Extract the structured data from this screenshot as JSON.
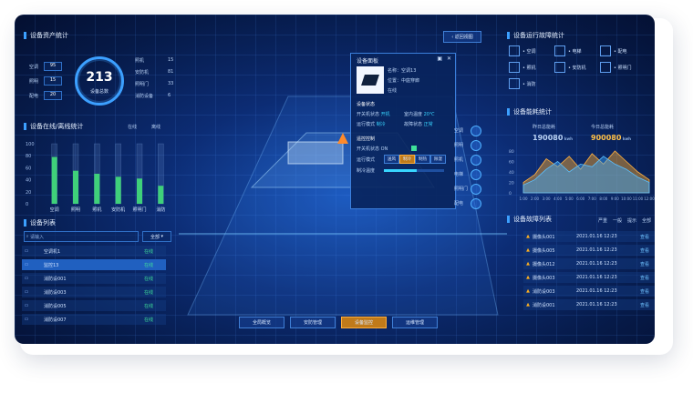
{
  "asset_stats": {
    "title": "设备资产统计",
    "total": "213",
    "total_label": "设备总数",
    "left": [
      {
        "label": "空调",
        "value": "95"
      },
      {
        "label": "照明",
        "value": "15"
      },
      {
        "label": "配电",
        "value": "20"
      }
    ],
    "right": [
      {
        "label": "照机",
        "value": "15"
      },
      {
        "label": "安防机",
        "value": "81"
      },
      {
        "label": "照明门",
        "value": "33"
      },
      {
        "label": "消防设备",
        "value": "6"
      }
    ]
  },
  "online_stats": {
    "title": "设备在线/离线统计",
    "legend_online": "在线",
    "legend_offline": "离线",
    "yticks": [
      "100",
      "80",
      "60",
      "40",
      "20",
      "0"
    ]
  },
  "chart_data": [
    {
      "type": "bar",
      "title": "设备在线/离线统计",
      "categories": [
        "空调",
        "照明",
        "照机",
        "安防机",
        "照明门",
        "消防"
      ],
      "series": [
        {
          "name": "在线",
          "values": [
            78,
            55,
            50,
            45,
            42,
            30
          ]
        }
      ],
      "ylim": [
        0,
        100
      ]
    },
    {
      "type": "area",
      "title": "设备能耗统计",
      "x": [
        "1:00",
        "2:00",
        "3:00",
        "4:00",
        "5:00",
        "6:00",
        "7:00",
        "8:00",
        "9:00",
        "10:00",
        "11:00",
        "12:00"
      ],
      "series": [
        {
          "name": "",
          "values": [
            20,
            35,
            65,
            50,
            70,
            45,
            75,
            55,
            80,
            60,
            40,
            25
          ]
        },
        {
          "name": "",
          "values": [
            15,
            25,
            45,
            60,
            40,
            55,
            50,
            70,
            55,
            45,
            30,
            20
          ]
        }
      ],
      "yticks": [
        "80",
        "60",
        "40",
        "20",
        "0"
      ],
      "ylim": [
        0,
        80
      ]
    }
  ],
  "device_list": {
    "title": "设备列表",
    "search_placeholder": "请输入",
    "filter": "全部",
    "rows": [
      {
        "name": "空调机1",
        "status": "在线",
        "selected": false
      },
      {
        "name": "监控13",
        "status": "在线",
        "selected": true
      },
      {
        "name": "消防设001",
        "status": "在线",
        "selected": false
      },
      {
        "name": "消防设003",
        "status": "在线",
        "selected": false
      },
      {
        "name": "消防设005",
        "status": "在线",
        "selected": false
      },
      {
        "name": "消防设007",
        "status": "在线",
        "selected": false
      }
    ]
  },
  "top": {
    "back_label": "返回视图"
  },
  "device_panel": {
    "title": "设备面板",
    "name_label": "名称",
    "name_value": "空调13",
    "position_label": "位置",
    "position_value": "中庭穿廊",
    "status_label": "在线",
    "section1": "设备状态",
    "switch_label": "开关机状态",
    "switch_value": "开机",
    "temp_label": "室内温度",
    "temp_value": "20℃",
    "mode_label": "运行模式",
    "mode_value": "制冷",
    "fault_label": "故障状态",
    "fault_value": "正常",
    "section2": "遥控控制",
    "ctrl_switch_label": "开关机状态",
    "ctrl_switch_value": "ON",
    "ctrl_mode_label": "运行模式",
    "modes": [
      "送风",
      "制冷",
      "制热",
      "除湿"
    ],
    "ctrl_temp_label": "制冷温度",
    "temp_slider": 0.55
  },
  "fault_stats": {
    "title": "设备运行故障统计",
    "items": [
      {
        "label": "空调",
        "icon": "ac-icon"
      },
      {
        "label": "电梯",
        "icon": "elevator-icon"
      },
      {
        "label": "配电",
        "icon": "power-icon"
      },
      {
        "label": "照机",
        "icon": "camera-icon"
      },
      {
        "label": "安防机",
        "icon": "security-icon"
      },
      {
        "label": "照明门",
        "icon": "door-icon"
      },
      {
        "label": "消防",
        "icon": "fire-icon"
      }
    ]
  },
  "energy": {
    "title": "设备能耗统计",
    "left_label": "昨日总能耗",
    "left_value": "190080",
    "left_unit": "kwh",
    "right_label": "今日总能耗",
    "right_value": "900080",
    "right_unit": "kwh"
  },
  "fault_list": {
    "title": "设备故障列表",
    "legends": [
      "严重",
      "一般",
      "提示",
      "全部"
    ],
    "rows": [
      {
        "name": "摄像头001",
        "time": "2021.01.16 12:23",
        "link": "查看"
      },
      {
        "name": "摄像头005",
        "time": "2021.01.16 12:23",
        "link": "查看"
      },
      {
        "name": "摄像头012",
        "time": "2021.01.16 12:23",
        "link": "查看"
      },
      {
        "name": "摄像头003",
        "time": "2021.01.16 12:23",
        "link": "查看"
      },
      {
        "name": "消防设003",
        "time": "2021.01.16 12:23",
        "link": "查看"
      },
      {
        "name": "消防设001",
        "time": "2021.01.16 12:23",
        "link": "查看"
      }
    ]
  },
  "nav": {
    "tabs": [
      {
        "label": "全局概览",
        "active": false
      },
      {
        "label": "安防管理",
        "active": false
      },
      {
        "label": "设备监控",
        "active": true
      },
      {
        "label": "运维管理",
        "active": false
      }
    ]
  },
  "checkpoints": [
    "空调",
    "照明",
    "照机",
    "电梯",
    "照明门",
    "配电"
  ],
  "colors": {
    "accent": "#38d6ff",
    "online": "#3fe09a",
    "warn": "#ffb020",
    "active_tab": "#c07a1a"
  }
}
